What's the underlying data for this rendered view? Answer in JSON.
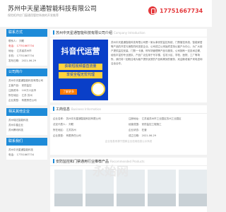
{
  "header": {
    "title": "苏州中天星通智能科技有限公司",
    "subtitle": "保险柜供应门窗通用管控系统的开发推荐",
    "phone": "17751667734"
  },
  "sidebar": {
    "contact": {
      "heading": "联系方式",
      "rows": [
        "联系人：  刘聪",
        "电话：  17751667734",
        "地址：  江苏省苏州市",
        "手机：  17751667734",
        "发布日期：  2021-06-29"
      ]
    },
    "company_intro": {
      "heading": "公司简介",
      "rows": [
        "苏州中天星通智能科技有限公司",
        "主营产品：  安防监控",
        "注册资本：  100万人民币",
        "所在地区：  江苏 苏州",
        "企业类型：  有限责任公司"
      ]
    },
    "related": {
      "heading": "相关其他企业",
      "rows": [
        "苏州瑞达智能科技",
        "苏州中星企业",
        "苏州腾讯科技"
      ]
    },
    "more": {
      "heading": "联系我们",
      "rows": [
        "苏州中天星通智能科技",
        "电话：  17751667734"
      ]
    }
  },
  "intro_card": {
    "heading": "苏州中天星通智能科技有限公司介绍",
    "heading_en": "Company Introduction",
    "ad": {
      "title": "抖音代运营",
      "line1": "获取短视频垂直流量",
      "line2": "享受全程无忧代理",
      "button": "了解更多"
    },
    "text": "苏州中天星通智能科技有限公司是一家从事安防监控系统、门禁管控系统、智能家居等产品的开发与销售的科技型企业。公司成立以来始终坚持以客户为中心，为广大用户提供监控安装、门禁一卡通、停车场管理等产品与服务。公司拥有一支技术过硬、经验丰富的专业团队，产品广泛应用于写字楼、住宅小区、学校、医院、工厂等场所。我们将一如既往地为客户提供优质的产品和周到的服务，欢迎新老客户来电咨询洽谈合作。"
  },
  "business_card": {
    "heading": "工商信息",
    "heading_en": "Business Information",
    "rows": [
      [
        "企业名称：  苏州中天星通智能科技有限公司",
        "注册地址：  江苏省苏州市工业园区苏州工业园区"
      ],
      [
        "法定代表人：  刘聪",
        "经营范围：  安防监控工程施工"
      ],
      [
        "所在地区：  江苏苏州",
        "企业状态：  在营"
      ],
      [
        "企业类型：  有限责任公司",
        "成立日期：  2021-06-29"
      ]
    ],
    "note": "企业信息来源于国家企业信用信息公示系统"
  },
  "product_card": {
    "heading": "安防监控和门禁通用行业推荐产品",
    "heading_en": "Recommended Products"
  },
  "watermark": "永始网"
}
